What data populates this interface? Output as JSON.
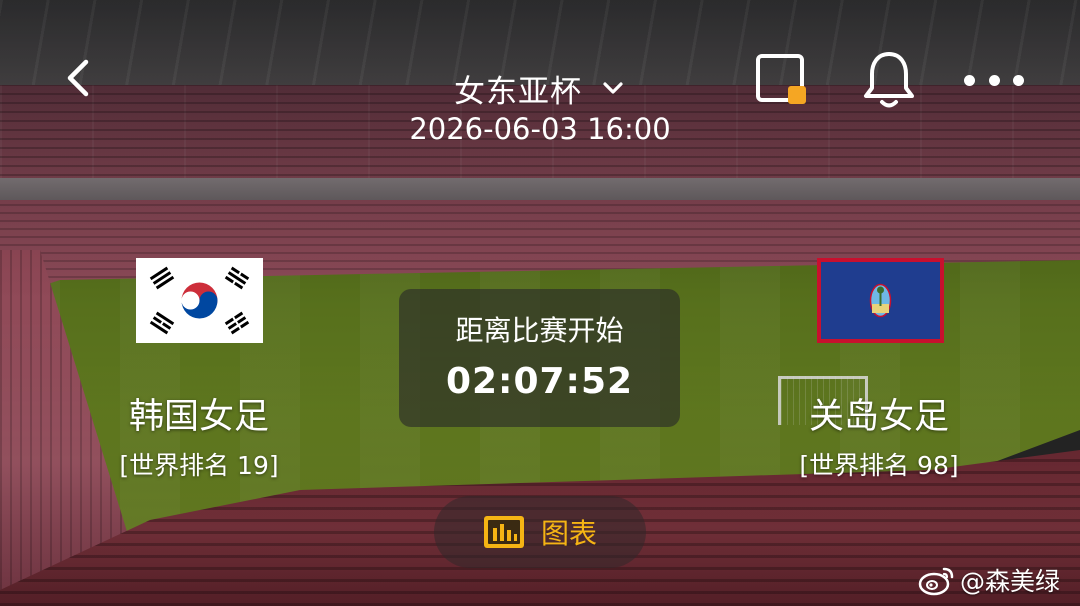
{
  "header": {
    "title": "女东亚杯",
    "datetime": "2026-06-03 16:00",
    "icons": [
      "back-arrow-icon",
      "chevron-down-icon",
      "floating-window-icon",
      "bell-icon",
      "more-icon"
    ],
    "accent_color": "#f5a623"
  },
  "match": {
    "home": {
      "name": "韩国女足",
      "rank": "[世界排名 19]",
      "flag": "south-korea-flag"
    },
    "away": {
      "name": "关岛女足",
      "rank": "[世界排名 98]",
      "flag": "guam-flag"
    },
    "countdown_label": "距离比赛开始",
    "countdown": "02:07:52"
  },
  "chart_button": {
    "label": "图表",
    "icon": "bar-chart-icon",
    "color": "#f5b414"
  },
  "watermark": {
    "text": "@森美绿",
    "icon": "weibo-logo"
  }
}
